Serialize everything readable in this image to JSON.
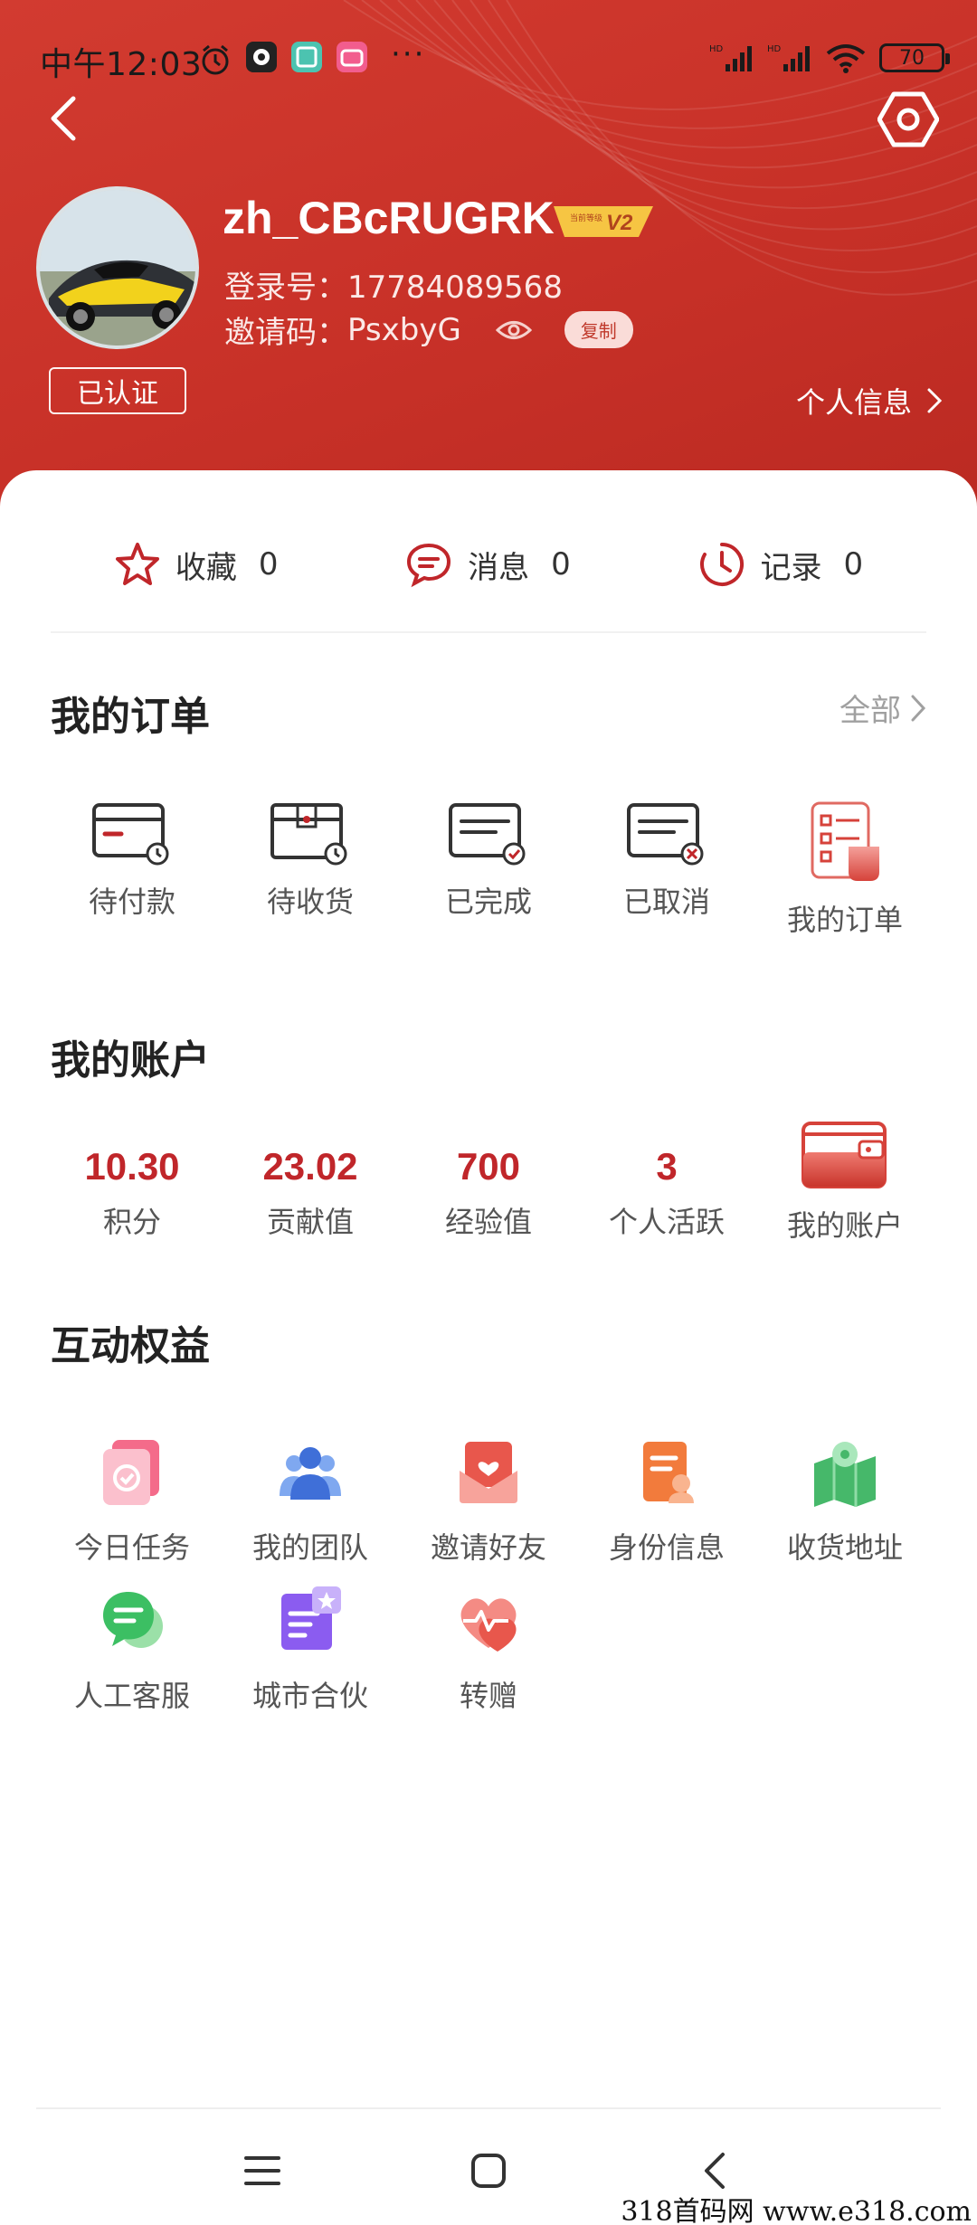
{
  "status_bar": {
    "time": "中午12:03",
    "dots": "···",
    "battery": "70"
  },
  "profile": {
    "username": "zh_CBcRUGRK",
    "level": "V2",
    "level_tag": "当前等级",
    "login_label": "登录号：",
    "login_value": "17784089568",
    "invite_label": "邀请码：",
    "invite_value": "PsxbyG",
    "copy_label": "复制",
    "verified_label": "已认证",
    "profile_link": "个人信息"
  },
  "quick": {
    "favorites_label": "收藏",
    "favorites_count": "0",
    "messages_label": "消息",
    "messages_count": "0",
    "records_label": "记录",
    "records_count": "0"
  },
  "orders": {
    "title": "我的订单",
    "see_all": "全部",
    "items": [
      {
        "label": "待付款",
        "icon": "card-clock-icon"
      },
      {
        "label": "待收货",
        "icon": "box-clock-icon"
      },
      {
        "label": "已完成",
        "icon": "card-check-icon"
      },
      {
        "label": "已取消",
        "icon": "card-cancel-icon"
      },
      {
        "label": "我的订单",
        "icon": "order-list-icon"
      }
    ]
  },
  "account": {
    "title": "我的账户",
    "items": [
      {
        "value": "10.30",
        "label": "积分"
      },
      {
        "value": "23.02",
        "label": "贡献值"
      },
      {
        "value": "700",
        "label": "经验值"
      },
      {
        "value": "3",
        "label": "个人活跃"
      }
    ],
    "wallet_label": "我的账户"
  },
  "perks": {
    "title": "互动权益",
    "items": [
      {
        "label": "今日任务",
        "icon": "task-icon"
      },
      {
        "label": "我的团队",
        "icon": "team-icon"
      },
      {
        "label": "邀请好友",
        "icon": "invite-icon"
      },
      {
        "label": "身份信息",
        "icon": "identity-icon"
      },
      {
        "label": "收货地址",
        "icon": "address-icon"
      },
      {
        "label": "人工客服",
        "icon": "service-icon"
      },
      {
        "label": "城市合伙",
        "icon": "city-partner-icon"
      },
      {
        "label": "转赠",
        "icon": "gift-transfer-icon"
      }
    ]
  },
  "watermark": "318首码网  www.e318.com",
  "colors": {
    "header_red": "#c83128",
    "accent_red": "#c0262a"
  }
}
